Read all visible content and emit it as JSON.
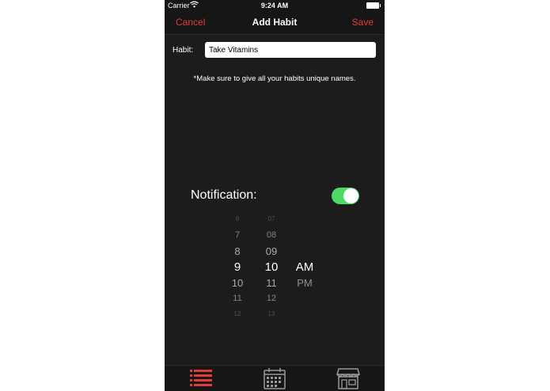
{
  "status_bar": {
    "carrier": "Carrier",
    "time": "9:24 AM"
  },
  "nav": {
    "cancel_label": "Cancel",
    "title": "Add Habit",
    "save_label": "Save"
  },
  "form": {
    "habit_label": "Habit:",
    "habit_value": "Take Vitamins",
    "hint": "*Make sure to give all your habits unique names."
  },
  "notification": {
    "label": "Notification:",
    "enabled": true
  },
  "time_picker": {
    "hour_column": [
      "6",
      "7",
      "8",
      "9",
      "10",
      "11",
      "12"
    ],
    "minute_column": [
      "07",
      "08",
      "09",
      "10",
      "11",
      "12",
      "13"
    ],
    "period_column": [
      "AM",
      "PM"
    ],
    "selected_hour": "9",
    "selected_minute": "10",
    "selected_period": "AM"
  },
  "tab_bar": {
    "items": [
      {
        "icon": "list-icon",
        "active": true
      },
      {
        "icon": "calendar-icon",
        "active": false
      },
      {
        "icon": "store-icon",
        "active": false
      }
    ]
  },
  "colors": {
    "accent": "#e33b35",
    "background": "#1c1c1c",
    "bar": "#161616",
    "toggle_on": "#4cd964"
  }
}
